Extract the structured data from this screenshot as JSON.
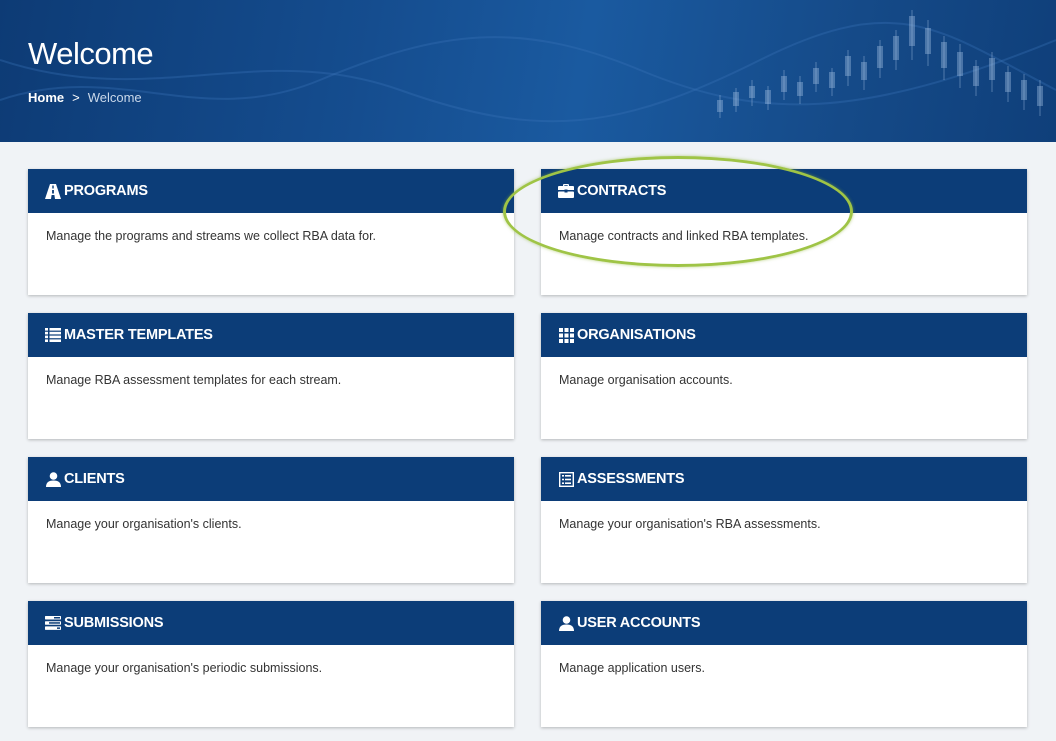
{
  "header": {
    "title": "Welcome",
    "breadcrumb": {
      "home": "Home",
      "separator": ">",
      "current": "Welcome"
    }
  },
  "cards": [
    {
      "title": "PROGRAMS",
      "icon": "road-icon",
      "description": "Manage the programs and streams we collect RBA data for."
    },
    {
      "title": "CONTRACTS",
      "icon": "briefcase-icon",
      "description": "Manage contracts and linked RBA templates."
    },
    {
      "title": "MASTER TEMPLATES",
      "icon": "list-icon",
      "description": "Manage RBA assessment templates for each stream."
    },
    {
      "title": "ORGANISATIONS",
      "icon": "grid-icon",
      "description": "Manage organisation accounts."
    },
    {
      "title": "CLIENTS",
      "icon": "user-icon",
      "description": "Manage your organisation's clients."
    },
    {
      "title": "ASSESSMENTS",
      "icon": "document-list-icon",
      "description": "Manage your organisation's RBA assessments."
    },
    {
      "title": "SUBMISSIONS",
      "icon": "tasks-icon",
      "description": "Manage your organisation's periodic submissions."
    },
    {
      "title": "USER ACCOUNTS",
      "icon": "user-icon",
      "description": "Manage application users."
    }
  ],
  "colors": {
    "header_bar": "#0c3d78",
    "highlight": "#9fc446",
    "background": "#f0f3f6"
  }
}
